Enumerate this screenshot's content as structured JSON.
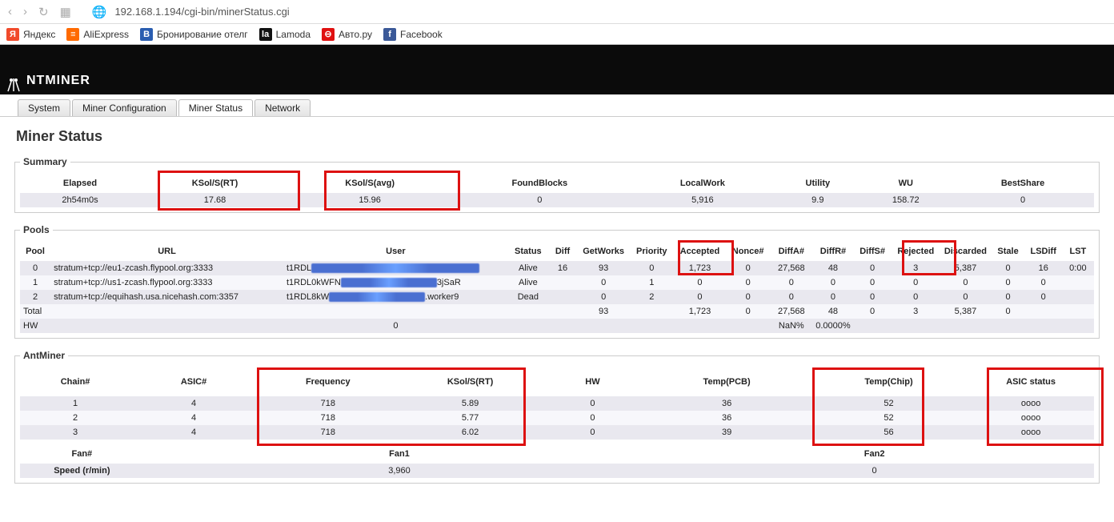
{
  "browser": {
    "url": "192.168.1.194/cgi-bin/minerStatus.cgi"
  },
  "bookmarks": [
    {
      "label": "Яндекс",
      "bg": "#f14a2b",
      "glyph": "Я"
    },
    {
      "label": "AliExpress",
      "bg": "#ff6a00",
      "glyph": "≡"
    },
    {
      "label": "Бронирование отелг",
      "bg": "#2a5db0",
      "glyph": "B"
    },
    {
      "label": "Lamoda",
      "bg": "#111",
      "glyph": "la"
    },
    {
      "label": "Авто.ру",
      "bg": "#e01010",
      "glyph": "⊖"
    },
    {
      "label": "Facebook",
      "bg": "#3b5998",
      "glyph": "f"
    }
  ],
  "brand": "NTMINER",
  "tabs": [
    "System",
    "Miner Configuration",
    "Miner Status",
    "Network"
  ],
  "active_tab": "Miner Status",
  "page_title": "Miner Status",
  "summary": {
    "legend": "Summary",
    "headers": [
      "Elapsed",
      "KSol/S(RT)",
      "KSol/S(avg)",
      "FoundBlocks",
      "LocalWork",
      "Utility",
      "WU",
      "BestShare"
    ],
    "row": [
      "2h54m0s",
      "17.68",
      "15.96",
      "0",
      "5,916",
      "9.9",
      "158.72",
      "0"
    ]
  },
  "pools": {
    "legend": "Pools",
    "headers": [
      "Pool",
      "URL",
      "User",
      "Status",
      "Diff",
      "GetWorks",
      "Priority",
      "Accepted",
      "Nonce#",
      "DiffA#",
      "DiffR#",
      "DiffS#",
      "Rejected",
      "Discarded",
      "Stale",
      "LSDiff",
      "LST"
    ],
    "rows": [
      {
        "id": "0",
        "url": "stratum+tcp://eu1-zcash.flypool.org:3333",
        "user": "t1RDL",
        "status": "Alive",
        "diff": "16",
        "getworks": "93",
        "prio": "0",
        "accepted": "1,723",
        "nonce": "0",
        "diffa": "27,568",
        "diffr": "48",
        "diffs": "0",
        "rejected": "3",
        "discarded": "5,387",
        "stale": "0",
        "lsdiff": "16",
        "lst": "0:00"
      },
      {
        "id": "1",
        "url": "stratum+tcp://us1-zcash.flypool.org:3333",
        "user": "t1RDL0kWFN",
        "usuffix": "3jSaR",
        "status": "Alive",
        "diff": "",
        "getworks": "0",
        "prio": "1",
        "accepted": "0",
        "nonce": "0",
        "diffa": "0",
        "diffr": "0",
        "diffs": "0",
        "rejected": "0",
        "discarded": "0",
        "stale": "0",
        "lsdiff": "0",
        "lst": ""
      },
      {
        "id": "2",
        "url": "stratum+tcp://equihash.usa.nicehash.com:3357",
        "user": "t1RDL8kW",
        "usuffix": ".worker9",
        "status": "Dead",
        "diff": "",
        "getworks": "0",
        "prio": "2",
        "accepted": "0",
        "nonce": "0",
        "diffa": "0",
        "diffr": "0",
        "diffs": "0",
        "rejected": "0",
        "discarded": "0",
        "stale": "0",
        "lsdiff": "0",
        "lst": ""
      }
    ],
    "total_label": "Total",
    "total": {
      "getworks": "93",
      "accepted": "1,723",
      "nonce": "0",
      "diffa": "27,568",
      "diffr": "48",
      "diffs": "0",
      "rejected": "3",
      "discarded": "5,387",
      "stale": "0"
    },
    "hw_label": "HW",
    "hw_val": "0",
    "hw_nan": "NaN%",
    "hw_pct": "0.0000%"
  },
  "antminer": {
    "legend": "AntMiner",
    "headers": [
      "Chain#",
      "ASIC#",
      "Frequency",
      "KSol/S(RT)",
      "HW",
      "Temp(PCB)",
      "Temp(Chip)",
      "ASIC status"
    ],
    "rows": [
      {
        "chain": "1",
        "asic": "4",
        "freq": "718",
        "ksol": "5.89",
        "hw": "0",
        "pcb": "36",
        "chip": "52",
        "status": "oooo"
      },
      {
        "chain": "2",
        "asic": "4",
        "freq": "718",
        "ksol": "5.77",
        "hw": "0",
        "pcb": "36",
        "chip": "52",
        "status": "oooo"
      },
      {
        "chain": "3",
        "asic": "4",
        "freq": "718",
        "ksol": "6.02",
        "hw": "0",
        "pcb": "39",
        "chip": "56",
        "status": "oooo"
      }
    ],
    "fan_headers": [
      "Fan#",
      "Fan1",
      "Fan2"
    ],
    "speed_label": "Speed (r/min)",
    "fan_vals": [
      "3,960",
      "0"
    ]
  }
}
